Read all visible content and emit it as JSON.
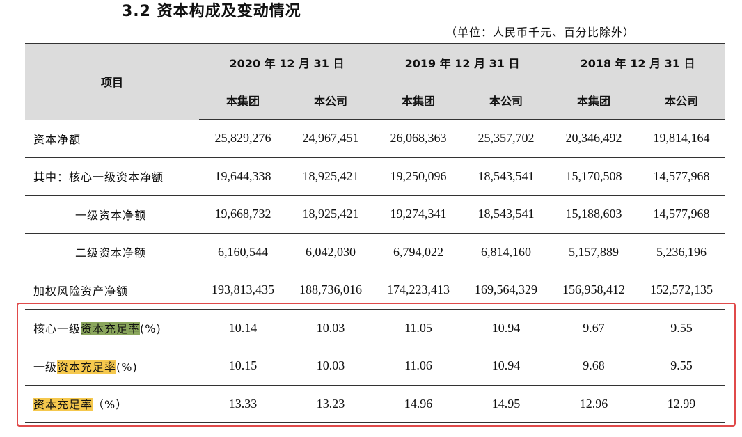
{
  "heading": "3.2 资本构成及变动情况",
  "unit_note": "（单位：人民币千元、百分比除外）",
  "table": {
    "item_header": "项目",
    "dates": [
      "2020 年 12 月 31 日",
      "2019 年 12 月 31 日",
      "2018 年 12 月 31 日"
    ],
    "sub_headers": [
      "本集团",
      "本公司",
      "本集团",
      "本公司",
      "本集团",
      "本公司"
    ],
    "rows": [
      {
        "label": "资本净额",
        "values": [
          "25,829,276",
          "24,967,451",
          "26,068,363",
          "25,357,702",
          "20,346,492",
          "19,814,164"
        ]
      },
      {
        "label": "其中：核心一级资本净额",
        "values": [
          "19,644,338",
          "18,925,421",
          "19,250,096",
          "18,543,541",
          "15,170,508",
          "14,577,968"
        ]
      },
      {
        "label": "一级资本净额",
        "values": [
          "19,668,732",
          "18,925,421",
          "19,274,341",
          "18,543,541",
          "15,188,603",
          "14,577,968"
        ]
      },
      {
        "label": "二级资本净额",
        "values": [
          "6,160,544",
          "6,042,030",
          "6,794,022",
          "6,814,160",
          "5,157,889",
          "5,236,196"
        ]
      },
      {
        "label": "加权风险资产净额",
        "values": [
          "193,813,435",
          "188,736,016",
          "174,223,413",
          "169,564,329",
          "156,958,412",
          "152,572,135"
        ]
      },
      {
        "label_prefix": "核心一级",
        "label_highlight": "资本充足率",
        "label_suffix": "(%)",
        "values": [
          "10.14",
          "10.03",
          "11.05",
          "10.94",
          "9.67",
          "9.55"
        ]
      },
      {
        "label_prefix": "一级",
        "label_highlight": "资本充足率",
        "label_suffix": "(%)",
        "values": [
          "10.15",
          "10.03",
          "11.06",
          "10.94",
          "9.68",
          "9.55"
        ]
      },
      {
        "label_prefix": "",
        "label_highlight": "资本充足率",
        "label_suffix": "（%）",
        "values": [
          "13.33",
          "13.23",
          "14.96",
          "14.95",
          "12.96",
          "12.99"
        ]
      }
    ]
  },
  "colors": {
    "highlight_green": "#8aa65c",
    "highlight_yellow": "#f5c84d",
    "annotation_box": "#e04a4a",
    "header_bg": "#dcdcdc"
  }
}
